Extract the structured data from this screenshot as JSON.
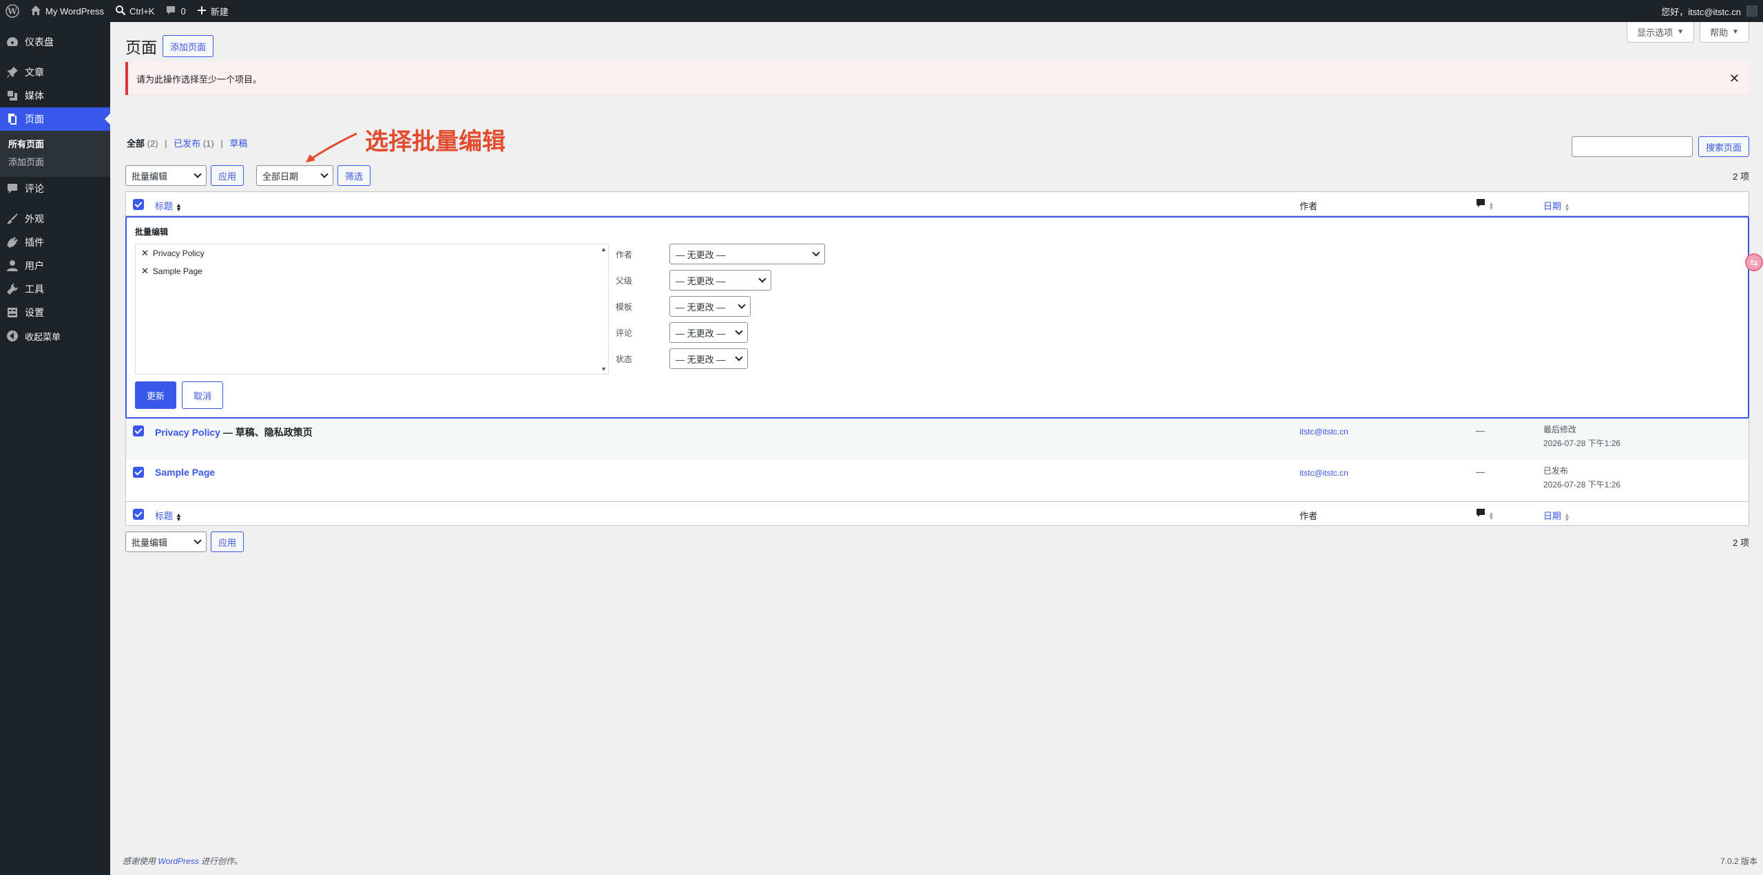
{
  "adminbar": {
    "site_name": "My WordPress",
    "search_shortcut": "Ctrl+K",
    "comments_count": "0",
    "new_label": "新建",
    "greeting": "您好，itstc@itstc.cn"
  },
  "sidebar": {
    "items": [
      {
        "label": "仪表盘",
        "icon": "dashboard-icon"
      },
      {
        "label": "文章",
        "icon": "pin-icon"
      },
      {
        "label": "媒体",
        "icon": "media-icon"
      },
      {
        "label": "页面",
        "icon": "pages-icon"
      },
      {
        "label": "评论",
        "icon": "comment-icon"
      },
      {
        "label": "外观",
        "icon": "brush-icon"
      },
      {
        "label": "插件",
        "icon": "plugin-icon"
      },
      {
        "label": "用户",
        "icon": "user-icon"
      },
      {
        "label": "工具",
        "icon": "wrench-icon"
      },
      {
        "label": "设置",
        "icon": "settings-icon"
      },
      {
        "label": "收起菜单",
        "icon": "collapse-icon"
      }
    ],
    "submenu": [
      "所有页面",
      "添加页面"
    ]
  },
  "screen_options": "显示选项",
  "help": "帮助",
  "page": {
    "title": "页面",
    "add_new": "添加页面"
  },
  "notice": "请为此操作选择至少一个项目。",
  "views": {
    "all": "全部",
    "all_count": "(2)",
    "published": "已发布",
    "published_count": "(1)",
    "draft_partial": "草稿"
  },
  "annotation": "选择批量编辑",
  "search_button": "搜索页面",
  "tablenav": {
    "bulk_action": "批量编辑",
    "apply": "应用",
    "dates": "全部日期",
    "filter": "筛选",
    "count": "2 项"
  },
  "columns": {
    "title": "标题",
    "author": "作者",
    "date": "日期"
  },
  "bulk_edit": {
    "heading": "批量编辑",
    "items": [
      "Privacy Policy",
      "Sample Page"
    ],
    "fields": [
      {
        "label": "作者",
        "value": "— 无更改 —"
      },
      {
        "label": "父级",
        "value": "— 无更改 —"
      },
      {
        "label": "模板",
        "value": "— 无更改 —"
      },
      {
        "label": "评论",
        "value": "— 无更改 —"
      },
      {
        "label": "状态",
        "value": "— 无更改 —"
      }
    ],
    "update": "更新",
    "cancel": "取消"
  },
  "rows": [
    {
      "title": "Privacy Policy",
      "state": " — 草稿、隐私政策页",
      "author": "itstc@itstc.cn",
      "comments": "—",
      "date_status": "最后修改",
      "date": "2026-07-28 下午1:26"
    },
    {
      "title": "Sample Page",
      "state": "",
      "author": "itstc@itstc.cn",
      "comments": "—",
      "date_status": "已发布",
      "date": "2026-07-28 下午1:26"
    }
  ],
  "footer": {
    "thanks_pre": "感谢使用",
    "wordpress": "WordPress",
    "thanks_post": "进行创作。",
    "version": "7.0.2 版本"
  },
  "colors": {
    "accent": "#3858e9",
    "adminbar": "#1d2327",
    "notice_error": "#d63638",
    "annotation": "#e34b2f"
  }
}
